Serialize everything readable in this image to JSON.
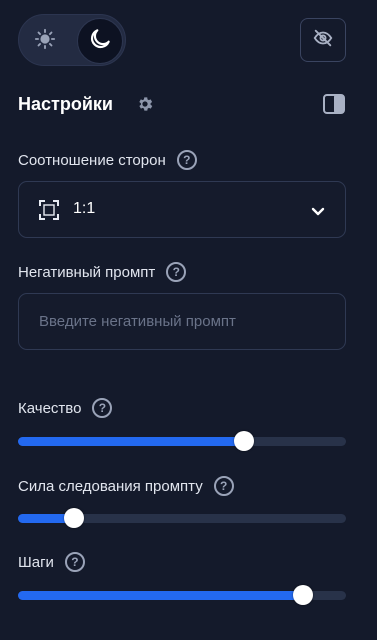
{
  "theme": {
    "light_icon": "sun-icon",
    "dark_icon": "moon-icon",
    "active": "dark"
  },
  "header": {
    "title": "Настройки",
    "settings_icon": "gear-icon",
    "panel_icon": "sidebar-panel-icon",
    "hide_icon": "eye-off-icon"
  },
  "aspect": {
    "label": "Соотношение сторон",
    "help": "?",
    "value": "1:1",
    "icon": "aspect-ratio-icon"
  },
  "negative": {
    "label": "Негативный промпт",
    "help": "?",
    "placeholder": "Введите негативный промпт",
    "value": ""
  },
  "quality": {
    "label": "Качество",
    "help": "?",
    "level": 0.69
  },
  "guidance": {
    "label": "Сила следования промпту",
    "help": "?",
    "level": 0.17
  },
  "steps": {
    "label": "Шаги",
    "help": "?",
    "level": 0.87
  },
  "colors": {
    "accent": "#2369f0",
    "background": "#141a2b",
    "track": "#283249"
  }
}
